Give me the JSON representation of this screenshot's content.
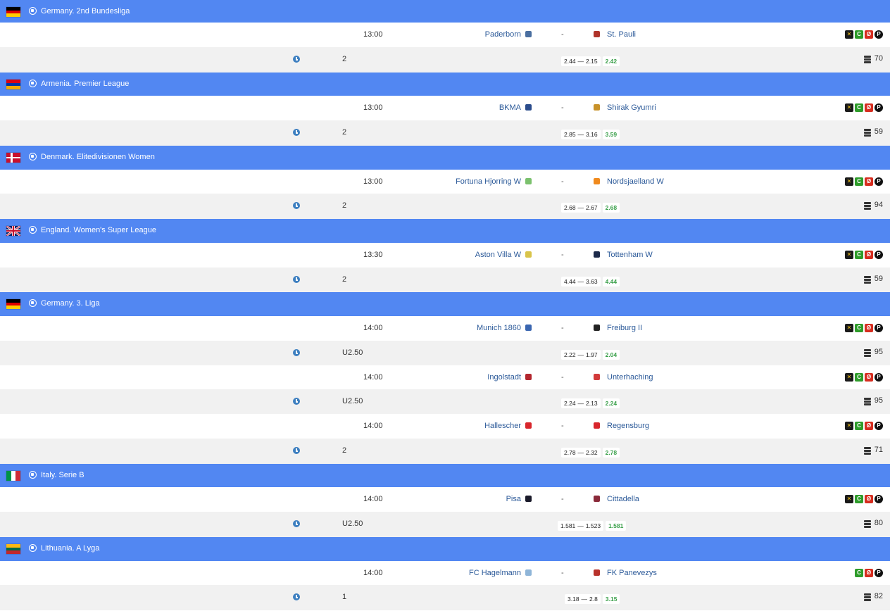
{
  "leagues": [
    {
      "name": "Germany. 2nd Bundesliga",
      "flag": "de",
      "matches": [
        {
          "time": "13:00",
          "home": "Paderborn",
          "away": "St. Pauli",
          "home_logo_color": "#4a6fa0",
          "away_logo_color": "#b0342b",
          "bookmakers": [
            "b1",
            "b2",
            "b3",
            "b4"
          ],
          "total": "2",
          "odds_from": "2.44",
          "odds_to": "2.15",
          "odds_current": "2.42",
          "count": "70"
        }
      ]
    },
    {
      "name": "Armenia. Premier League",
      "flag": "am",
      "matches": [
        {
          "time": "13:00",
          "home": "BKMA",
          "away": "Shirak Gyumri",
          "home_logo_color": "#2b4c8c",
          "away_logo_color": "#c8922a",
          "bookmakers": [
            "b1",
            "b2",
            "b3",
            "b4"
          ],
          "total": "2",
          "odds_from": "2.85",
          "odds_to": "3.16",
          "odds_current": "3.59",
          "count": "59"
        }
      ]
    },
    {
      "name": "Denmark. Elitedivisionen Women",
      "flag": "dk",
      "matches": [
        {
          "time": "13:00",
          "home": "Fortuna Hjorring W",
          "away": "Nordsjaelland W",
          "home_logo_color": "#7bc16d",
          "away_logo_color": "#f08a1d",
          "bookmakers": [
            "b1",
            "b2",
            "b3",
            "b4"
          ],
          "total": "2",
          "odds_from": "2.68",
          "odds_to": "2.67",
          "odds_current": "2.68",
          "count": "94"
        }
      ]
    },
    {
      "name": "England. Women's Super League",
      "flag": "gb",
      "matches": [
        {
          "time": "13:30",
          "home": "Aston Villa W",
          "away": "Tottenham W",
          "home_logo_color": "#d9c44a",
          "away_logo_color": "#1d2a4a",
          "bookmakers": [
            "b1",
            "b2",
            "b3",
            "b4"
          ],
          "total": "2",
          "odds_from": "4.44",
          "odds_to": "3.63",
          "odds_current": "4.44",
          "count": "59"
        }
      ]
    },
    {
      "name": "Germany. 3. Liga",
      "flag": "de",
      "matches": [
        {
          "time": "14:00",
          "home": "Munich 1860",
          "away": "Freiburg II",
          "home_logo_color": "#3a66b0",
          "away_logo_color": "#222222",
          "bookmakers": [
            "b1",
            "b2",
            "b3",
            "b4"
          ],
          "total": "U2.50",
          "odds_from": "2.22",
          "odds_to": "1.97",
          "odds_current": "2.04",
          "count": "95"
        },
        {
          "time": "14:00",
          "home": "Ingolstadt",
          "away": "Unterhaching",
          "home_logo_color": "#b3262e",
          "away_logo_color": "#d23a3a",
          "bookmakers": [
            "b1",
            "b2",
            "b3",
            "b4"
          ],
          "total": "U2.50",
          "odds_from": "2.24",
          "odds_to": "2.13",
          "odds_current": "2.24",
          "count": "95"
        },
        {
          "time": "14:00",
          "home": "Hallescher",
          "away": "Regensburg",
          "home_logo_color": "#d8262c",
          "away_logo_color": "#d8262c",
          "bookmakers": [
            "b1",
            "b2",
            "b3",
            "b4"
          ],
          "total": "2",
          "odds_from": "2.78",
          "odds_to": "2.32",
          "odds_current": "2.78",
          "count": "71"
        }
      ]
    },
    {
      "name": "Italy. Serie B",
      "flag": "it",
      "matches": [
        {
          "time": "14:00",
          "home": "Pisa",
          "away": "Cittadella",
          "home_logo_color": "#1a1a2a",
          "away_logo_color": "#8a2a3a",
          "bookmakers": [
            "b1",
            "b2",
            "b3",
            "b4"
          ],
          "total": "U2.50",
          "odds_from": "1.581",
          "odds_to": "1.523",
          "odds_current": "1.581",
          "count": "80"
        }
      ]
    },
    {
      "name": "Lithuania. A Lyga",
      "flag": "lt",
      "matches": [
        {
          "time": "14:00",
          "home": "FC Hagelmann",
          "away": "FK Panevezys",
          "home_logo_color": "#8fb5d8",
          "away_logo_color": "#b8322c",
          "bookmakers": [
            "b2",
            "b3",
            "b4"
          ],
          "total": "1",
          "odds_from": "3.18",
          "odds_to": "2.8",
          "odds_current": "3.15",
          "count": "82"
        }
      ]
    }
  ],
  "odds_separator": "—",
  "match_dash": "-",
  "bookmaker_glyphs": {
    "b1": "✕",
    "b2": "C",
    "b3": "Ø",
    "b4": "P"
  },
  "colors": {
    "header": "#5287f2",
    "team_link": "#2c5a99",
    "odds_current": "#3aa04a",
    "odds_row_bg": "#f1f1f1"
  }
}
